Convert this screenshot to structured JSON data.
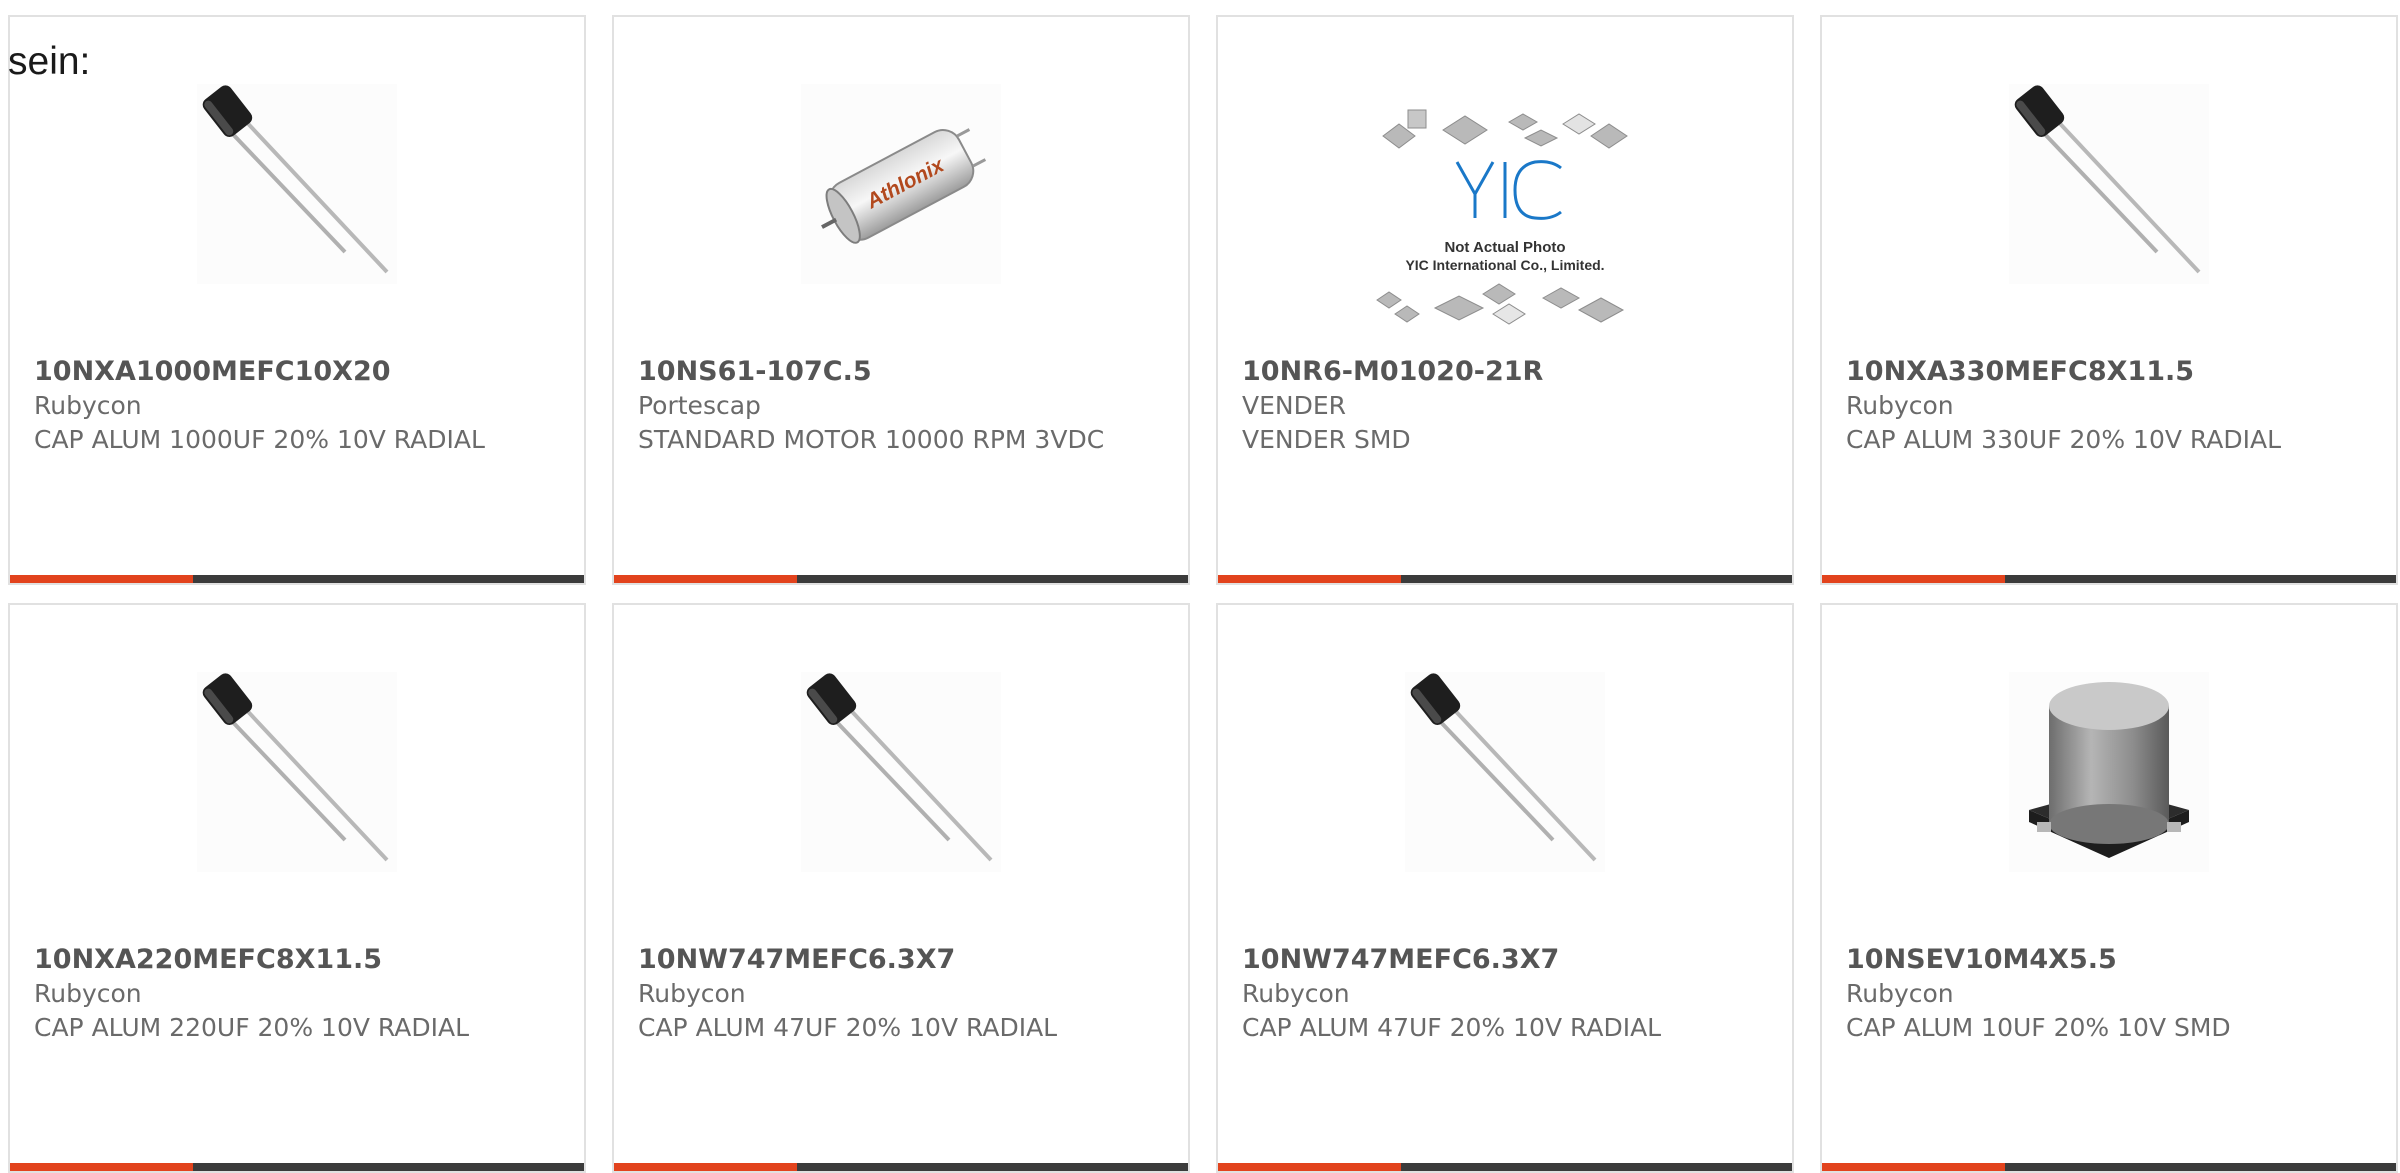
{
  "lead_text": "sein:",
  "colors": {
    "accent": "#e2431d",
    "bar": "#3b3b3b",
    "border": "#e1e1e1",
    "text": "#6a6a6a"
  },
  "products": [
    {
      "part_number": "10NXA1000MEFC10X20",
      "manufacturer": "Rubycon",
      "description": "CAP ALUM 1000UF 20% 10V RADIAL",
      "image": "radial-capacitor-icon"
    },
    {
      "part_number": "10NS61-107C.5",
      "manufacturer": "Portescap",
      "description": "STANDARD MOTOR 10000 RPM 3VDC",
      "image": "dc-motor-icon",
      "image_label": "Athlonix"
    },
    {
      "part_number": "10NR6-M01020-21R",
      "manufacturer": "VENDER",
      "description": "VENDER SMD",
      "image": "placeholder-chips-icon",
      "image_text": {
        "logo": "YIC",
        "line1": "Not Actual Photo",
        "line2": "YIC International Co., Limited."
      }
    },
    {
      "part_number": "10NXA330MEFC8X11.5",
      "manufacturer": "Rubycon",
      "description": "CAP ALUM 330UF 20% 10V RADIAL",
      "image": "radial-capacitor-icon"
    },
    {
      "part_number": "10NXA220MEFC8X11.5",
      "manufacturer": "Rubycon",
      "description": "CAP ALUM 220UF 20% 10V RADIAL",
      "image": "radial-capacitor-icon"
    },
    {
      "part_number": "10NW747MEFC6.3X7",
      "manufacturer": "Rubycon",
      "description": "CAP ALUM 47UF 20% 10V RADIAL",
      "image": "radial-capacitor-icon"
    },
    {
      "part_number": "10NW747MEFC6.3X7",
      "manufacturer": "Rubycon",
      "description": "CAP ALUM 47UF 20% 10V RADIAL",
      "image": "radial-capacitor-icon"
    },
    {
      "part_number": "10NSEV10M4X5.5",
      "manufacturer": "Rubycon",
      "description": "CAP ALUM 10UF 20% 10V SMD",
      "image": "smd-capacitor-icon"
    }
  ]
}
